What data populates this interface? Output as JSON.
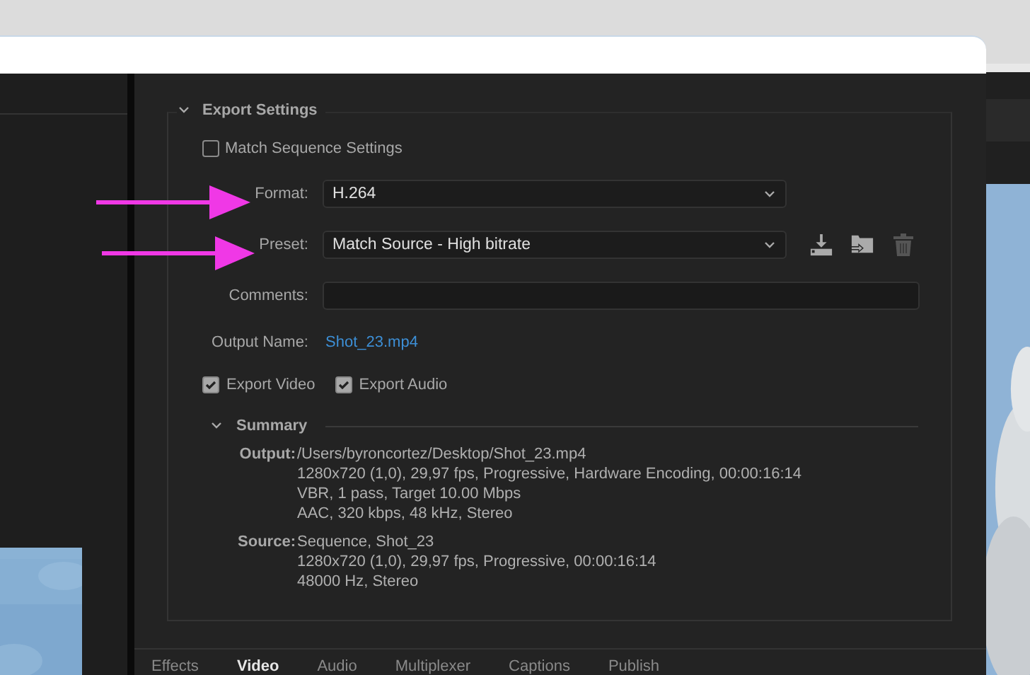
{
  "export_settings": {
    "title": "Export Settings",
    "expanded": true,
    "match_sequence": {
      "label": "Match Sequence Settings",
      "checked": false
    },
    "fields": [
      {
        "kind": "select",
        "label": "Format:",
        "value": "H.264"
      },
      {
        "kind": "select",
        "label": "Preset:",
        "value": "Match Source - High bitrate",
        "actions": true
      },
      {
        "kind": "input",
        "label": "Comments:"
      },
      {
        "kind": "link",
        "label": "Output Name:",
        "value": "Shot_23.mp4"
      }
    ],
    "exports": [
      {
        "label": "Export Video",
        "checked": true
      },
      {
        "label": "Export Audio",
        "checked": true
      }
    ],
    "summary": {
      "title": "Summary",
      "expanded": true,
      "entries": [
        {
          "label": "Output:",
          "lines": [
            "/Users/byroncortez/Desktop/Shot_23.mp4",
            "1280x720 (1,0), 29,97 fps, Progressive, Hardware Encoding, 00:00:16:14",
            "VBR, 1 pass, Target 10.00 Mbps",
            "AAC, 320 kbps, 48 kHz, Stereo"
          ]
        },
        {
          "label": "Source:",
          "lines": [
            "Sequence, Shot_23",
            "1280x720 (1,0), 29,97 fps, Progressive, 00:00:16:14",
            "48000 Hz, Stereo"
          ]
        }
      ]
    }
  },
  "tabs": [
    {
      "label": "Effects",
      "selected": false
    },
    {
      "label": "Video",
      "selected": true
    },
    {
      "label": "Audio",
      "selected": false
    },
    {
      "label": "Multiplexer",
      "selected": false
    },
    {
      "label": "Captions",
      "selected": false
    },
    {
      "label": "Publish",
      "selected": false
    }
  ]
}
